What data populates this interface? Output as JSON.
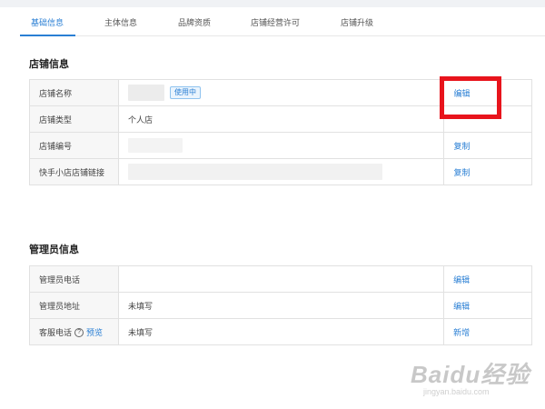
{
  "tabs": [
    {
      "label": "基础信息",
      "active": true
    },
    {
      "label": "主体信息",
      "active": false
    },
    {
      "label": "品牌资质",
      "active": false
    },
    {
      "label": "店铺经营许可",
      "active": false
    },
    {
      "label": "店铺升级",
      "active": false
    }
  ],
  "shop_section": {
    "title": "店铺信息",
    "rows": [
      {
        "label": "店铺名称",
        "value": "",
        "badge": "使用中",
        "action": "编辑"
      },
      {
        "label": "店铺类型",
        "value": "个人店",
        "action": ""
      },
      {
        "label": "店铺编号",
        "value": "",
        "action": "复制"
      },
      {
        "label": "快手小店店铺链接",
        "value": "",
        "action": "复制"
      }
    ]
  },
  "admin_section": {
    "title": "管理员信息",
    "rows": [
      {
        "label": "管理员电话",
        "value": "",
        "action": "编辑"
      },
      {
        "label": "管理员地址",
        "value": "未填写",
        "action": "编辑"
      },
      {
        "label": "客服电话",
        "help_icon": "?",
        "preview": "预览",
        "value": "未填写",
        "action": "新增"
      }
    ]
  },
  "watermark": {
    "brand": "Baidu经验",
    "url": "jingyan.baidu.com"
  },
  "colors": {
    "accent": "#2a7fd4",
    "highlight": "#e8141c"
  }
}
